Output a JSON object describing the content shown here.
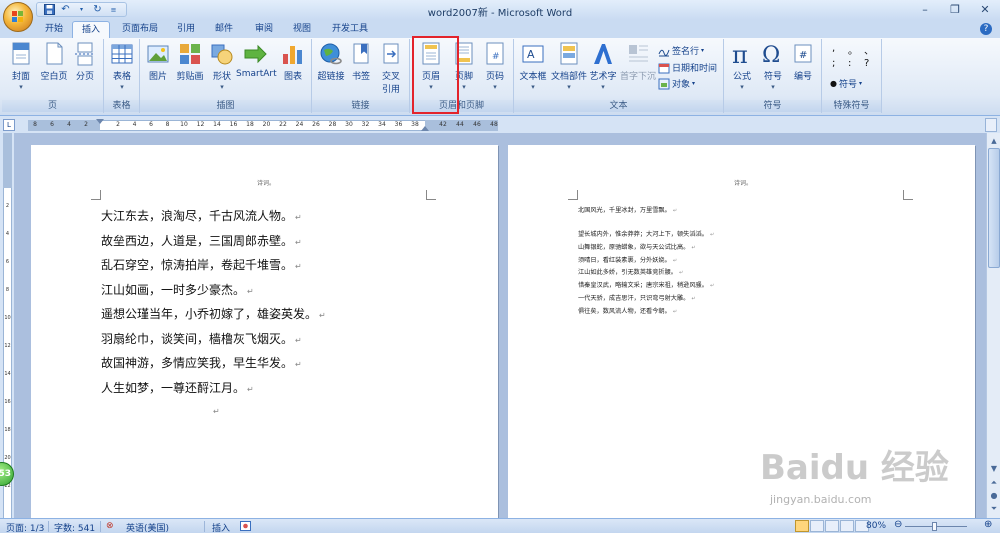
{
  "window": {
    "title": "word2007新 - Microsoft Word",
    "qat": {
      "save": "save-icon",
      "undo": "undo-icon",
      "repeat": "redo-icon"
    },
    "controls": {
      "minimize": "–",
      "restore": "❐",
      "close": "✕"
    }
  },
  "tabs": [
    "开始",
    "插入",
    "页面布局",
    "引用",
    "邮件",
    "审阅",
    "视图",
    "开发工具"
  ],
  "active_tab": "插入",
  "ribbon": {
    "groups": {
      "pages": "页",
      "tables": "表格",
      "illustrations": "插图",
      "links": "链接",
      "header_footer": "页眉和页脚",
      "text": "文本",
      "symbols": "符号",
      "special": "特殊符号"
    },
    "buttons": {
      "cover": "封面",
      "blank_page": "空白页",
      "page_break": "分页",
      "table": "表格",
      "picture": "图片",
      "clipart": "剪贴画",
      "shapes": "形状",
      "smartart": "SmartArt",
      "chart": "图表",
      "hyperlink": "超链接",
      "bookmark": "书签",
      "crossref_1": "交叉",
      "crossref_2": "引用",
      "header": "页眉",
      "footer": "页脚",
      "page_number": "页码",
      "textbox": "文本框",
      "quickparts": "文档部件",
      "wordart": "艺术字",
      "dropcap": "首字下沉",
      "signature": "签名行",
      "datetime": "日期和时间",
      "object": "对象",
      "equation": "公式",
      "symbol": "符号",
      "number": "编号",
      "special_symbol": "符号"
    },
    "special_marks": [
      ",",
      "。",
      "、",
      ";",
      ":",
      "?"
    ]
  },
  "ruler": {
    "numbers": [
      "8",
      "6",
      "4",
      "2",
      "2",
      "4",
      "6",
      "8",
      "10",
      "12",
      "14",
      "16",
      "18",
      "20",
      "22",
      "24",
      "26",
      "28",
      "30",
      "32",
      "34",
      "36",
      "38",
      "42",
      "44",
      "46",
      "48"
    ]
  },
  "vruler": {
    "numbers": [
      "2",
      "4",
      "6",
      "8",
      "10",
      "12",
      "14",
      "16",
      "18",
      "20",
      "22"
    ]
  },
  "page1": {
    "header": "诗词。",
    "lines": [
      "大江东去，浪淘尽，千古风流人物。",
      "故垒西边，人道是，三国周郎赤壁。",
      "乱石穿空，惊涛拍岸，卷起千堆雪。",
      "江山如画，一时多少豪杰。",
      "遥想公瑾当年，小乔初嫁了，雄姿英发。",
      "羽扇纶巾，谈笑间，樯橹灰飞烟灭。",
      "故国神游，多情应笑我，早生华发。",
      "人生如梦，一尊还酹江月。"
    ],
    "para_mark": "↵"
  },
  "page2": {
    "header": "诗词。",
    "lines": [
      "北国风光，千里冰封，万里雪飘。",
      "",
      "望长城内外，惟余莽莽；大河上下，顿失滔滔。",
      "山舞银蛇，原驰蜡象，欲与天公试比高。",
      "须晴日，看红装素裹，分外妖娆。",
      "江山如此多娇，引无数英雄竞折腰。",
      "惜秦皇汉武，略输文采；唐宗宋祖，稍逊风骚。",
      "一代天骄，成吉思汗，只识弯弓射大雕。",
      "俱往矣，数风流人物，还看今朝。"
    ]
  },
  "status": {
    "page": "页面: 1/3",
    "words": "字数: 541",
    "language": "英语(美国)",
    "mode": "插入",
    "zoom": "80%",
    "zoom_level": 0.8
  },
  "overlays": {
    "badge": "53",
    "watermark": "Baidu 经验",
    "watermark_url": "jingyan.baidu.com"
  },
  "colors": {
    "highlight": "#e3232b",
    "accent": "#15428b"
  }
}
